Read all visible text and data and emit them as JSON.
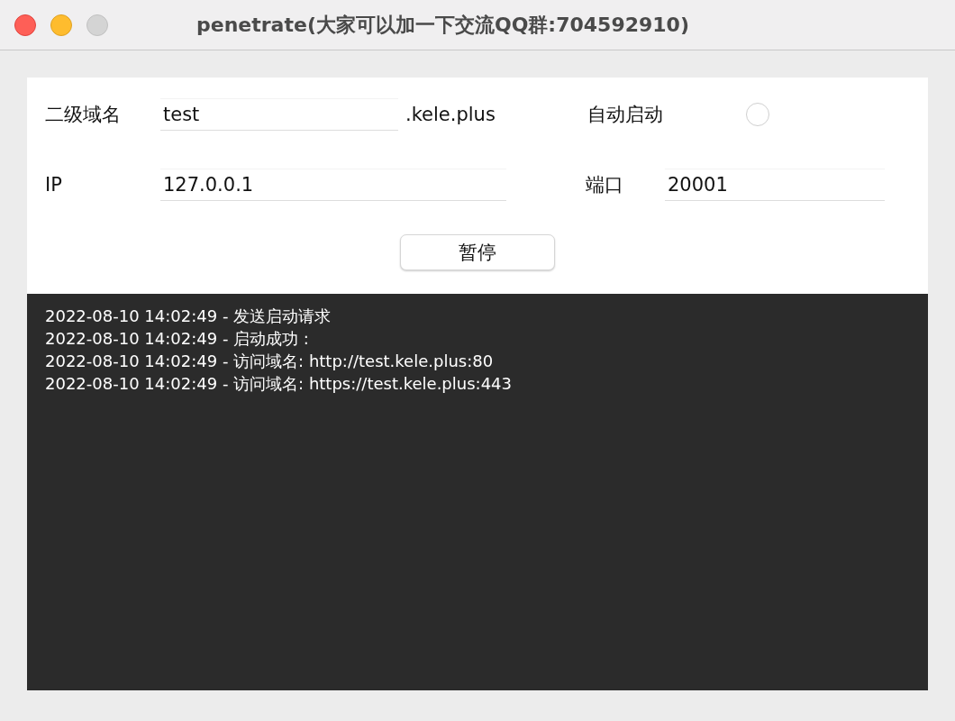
{
  "window": {
    "title": "penetrate(大家可以加一下交流QQ群:704592910)"
  },
  "form": {
    "subdomain": {
      "label": "二级域名",
      "value": "test",
      "suffix": ".kele.plus"
    },
    "autostart": {
      "label": "自动启动",
      "checked": false
    },
    "ip": {
      "label": "IP",
      "value": "127.0.0.1"
    },
    "port": {
      "label": "端口",
      "value": "20001"
    },
    "button": "暂停"
  },
  "log": [
    "2022-08-10 14:02:49 - 发送启动请求",
    "2022-08-10 14:02:49 - 启动成功 :",
    "2022-08-10 14:02:49 - 访问域名: http://test.kele.plus:80",
    "2022-08-10 14:02:49 - 访问域名: https://test.kele.plus:443"
  ]
}
